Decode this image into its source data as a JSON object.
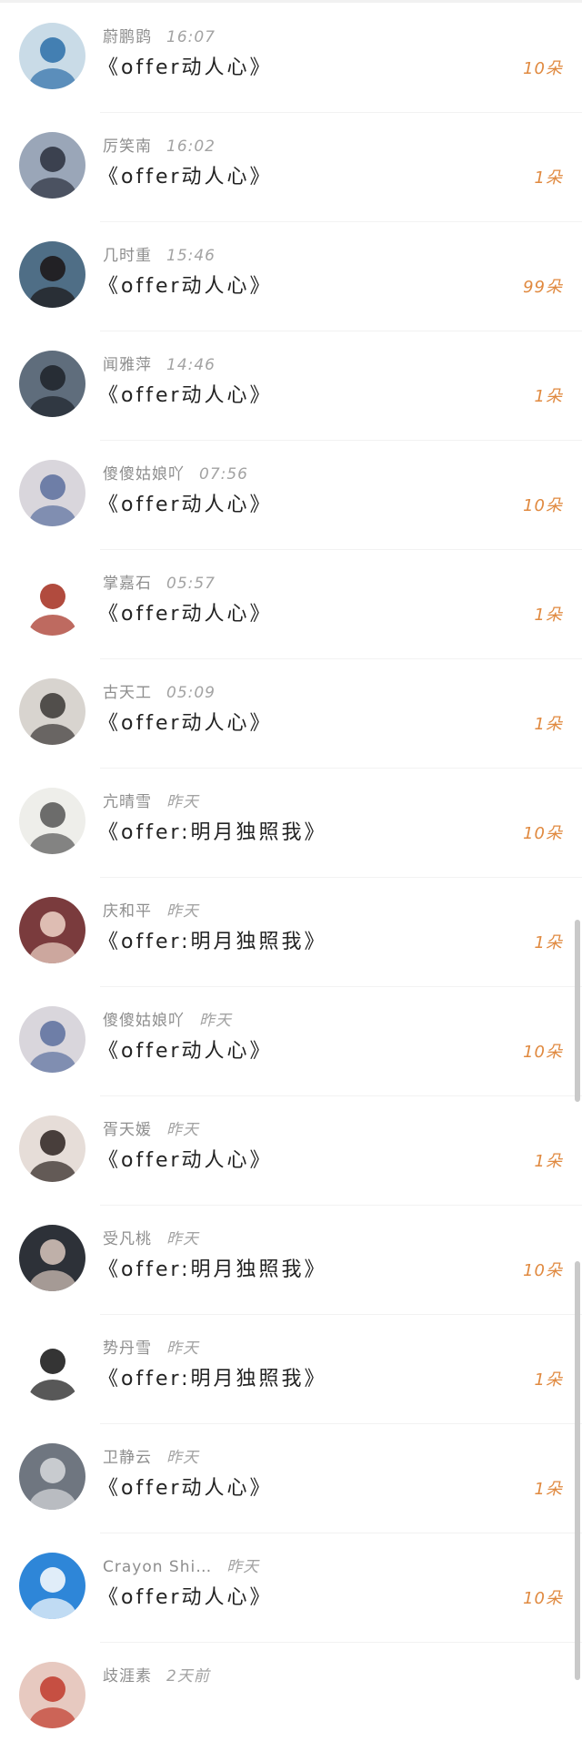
{
  "gifts": [
    {
      "sender": "蔚鹏鹍",
      "time": "16:07",
      "gift": "《offer动人心》",
      "count": "10朵",
      "avatar": "avatar-girl-blue-hair",
      "bg": "#c9dbe7",
      "fg": "#2c6ea8"
    },
    {
      "sender": "厉笑南",
      "time": "16:02",
      "gift": "《offer动人心》",
      "count": "1朵",
      "avatar": "avatar-man-photo",
      "bg": "#9aa6b8",
      "fg": "#2a2f3c"
    },
    {
      "sender": "几时重",
      "time": "15:46",
      "gift": "《offer动人心》",
      "count": "99朵",
      "avatar": "avatar-anime-girl",
      "bg": "#4f6e86",
      "fg": "#1a1414"
    },
    {
      "sender": "闻雅萍",
      "time": "14:46",
      "gift": "《offer动人心》",
      "count": "1朵",
      "avatar": "avatar-dark-portrait",
      "bg": "#5f6d7c",
      "fg": "#1d2229"
    },
    {
      "sender": "傻傻姑娘吖",
      "time": "07:56",
      "gift": "《offer动人心》",
      "count": "10朵",
      "avatar": "avatar-girl-heart",
      "bg": "#d9d6dc",
      "fg": "#5a6f9e"
    },
    {
      "sender": "掌嘉石",
      "time": "05:57",
      "gift": "《offer动人心》",
      "count": "1朵",
      "avatar": "avatar-fu-character",
      "bg": "#ffffff",
      "fg": "#a32b1c"
    },
    {
      "sender": "古天工",
      "time": "05:09",
      "gift": "《offer动人心》",
      "count": "1朵",
      "avatar": "avatar-beach-figure",
      "bg": "#d8d4cf",
      "fg": "#3a3634"
    },
    {
      "sender": "亢晴雪",
      "time": "昨天",
      "gift": "《offer:明月独照我》",
      "count": "10朵",
      "avatar": "avatar-ink-painting",
      "bg": "#eeeeea",
      "fg": "#555555"
    },
    {
      "sender": "庆和平",
      "time": "昨天",
      "gift": "《offer:明月独照我》",
      "count": "1朵",
      "avatar": "avatar-woman-red-hair",
      "bg": "#7a3b3d",
      "fg": "#f0d5c8"
    },
    {
      "sender": "傻傻姑娘吖",
      "time": "昨天",
      "gift": "《offer动人心》",
      "count": "10朵",
      "avatar": "avatar-girl-heart",
      "bg": "#d9d6dc",
      "fg": "#5a6f9e"
    },
    {
      "sender": "胥天媛",
      "time": "昨天",
      "gift": "《offer动人心》",
      "count": "1朵",
      "avatar": "avatar-girl-portrait",
      "bg": "#e6ddd8",
      "fg": "#2b2220"
    },
    {
      "sender": "受凡桃",
      "time": "昨天",
      "gift": "《offer:明月独照我》",
      "count": "10朵",
      "avatar": "avatar-dark-boy",
      "bg": "#2d3138",
      "fg": "#d9c7bd"
    },
    {
      "sender": "势丹雪",
      "time": "昨天",
      "gift": "《offer:明月独照我》",
      "count": "1朵",
      "avatar": "avatar-cartoon-doodle",
      "bg": "#ffffff",
      "fg": "#111111"
    },
    {
      "sender": "卫静云",
      "time": "昨天",
      "gift": "《offer动人心》",
      "count": "1朵",
      "avatar": "avatar-grey-hair-anime",
      "bg": "#6f7680",
      "fg": "#d8dadd"
    },
    {
      "sender": "Crayon Shi…",
      "time": "昨天",
      "gift": "《offer动人心》",
      "count": "10朵",
      "avatar": "avatar-crayon-shin-chan",
      "bg": "#2e86d8",
      "fg": "#ffffff"
    },
    {
      "sender": "歧涯素",
      "time": "2天前",
      "gift": "",
      "count": "",
      "avatar": "avatar-partial",
      "bg": "#e7c9c0",
      "fg": "#c0392b"
    }
  ]
}
